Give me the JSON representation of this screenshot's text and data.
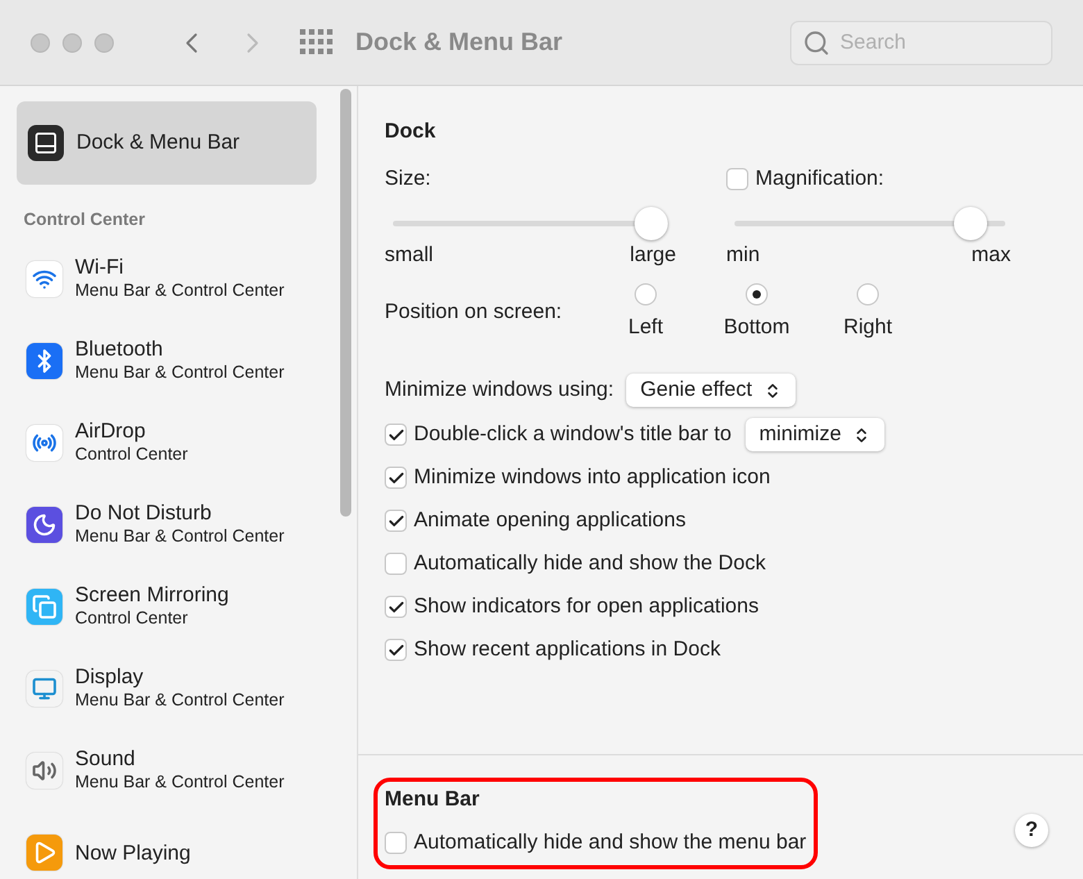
{
  "window": {
    "title": "Dock & Menu Bar"
  },
  "search": {
    "placeholder": "Search"
  },
  "sidebar": {
    "top_item": {
      "title": "Dock & Menu Bar",
      "selected": true
    },
    "section": "Control Center",
    "items": [
      {
        "kind": "wifi",
        "title": "Wi-Fi",
        "subtitle": "Menu Bar & Control Center",
        "selected": false
      },
      {
        "kind": "bluetooth",
        "title": "Bluetooth",
        "subtitle": "Menu Bar & Control Center",
        "selected": false
      },
      {
        "kind": "airdrop",
        "title": "AirDrop",
        "subtitle": "Control Center",
        "selected": false
      },
      {
        "kind": "moon",
        "title": "Do Not Disturb",
        "subtitle": "Menu Bar & Control Center",
        "selected": false
      },
      {
        "kind": "mirroring",
        "title": "Screen Mirroring",
        "subtitle": "Control Center",
        "selected": false
      },
      {
        "kind": "display",
        "title": "Display",
        "subtitle": "Menu Bar & Control Center",
        "selected": false
      },
      {
        "kind": "sound",
        "title": "Sound",
        "subtitle": "Menu Bar & Control Center",
        "selected": false
      },
      {
        "kind": "play",
        "title": "Now Playing",
        "selected": false
      }
    ]
  },
  "dock": {
    "heading": "Dock",
    "size": {
      "label": "Size:",
      "level": 0.94,
      "min_label": "small",
      "max_label": "large"
    },
    "magnification": {
      "label": "Magnification:",
      "checked": false,
      "level": 0.87,
      "min_label": "min",
      "max_label": "max"
    },
    "position": {
      "label": "Position on screen:",
      "options": [
        {
          "label": "Left",
          "selected": false
        },
        {
          "label": "Bottom",
          "selected": true
        },
        {
          "label": "Right",
          "selected": false
        }
      ]
    },
    "minimize": {
      "label": "Minimize windows using:",
      "value": "Genie effect"
    },
    "checkboxes": [
      {
        "label": "Double-click a window's title bar to",
        "checked": true,
        "popup": "minimize"
      },
      {
        "label": "Minimize windows into application icon",
        "checked": true
      },
      {
        "label": "Animate opening applications",
        "checked": true
      },
      {
        "label": "Automatically hide and show the Dock",
        "checked": false
      },
      {
        "label": "Show indicators for open applications",
        "checked": true
      },
      {
        "label": "Show recent applications in Dock",
        "checked": true
      }
    ]
  },
  "menu_bar": {
    "heading": "Menu Bar",
    "highlighted": true,
    "checkbox": {
      "label": "Automatically hide and show the menu bar",
      "checked": false
    }
  },
  "help": "?"
}
